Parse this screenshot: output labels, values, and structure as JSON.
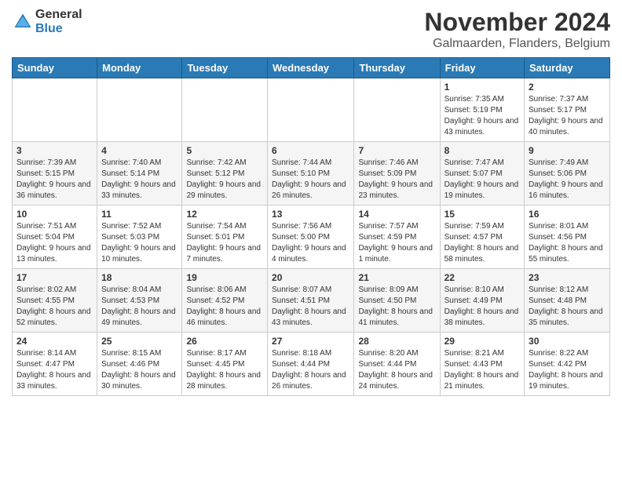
{
  "header": {
    "logo_general": "General",
    "logo_blue": "Blue",
    "month_title": "November 2024",
    "location": "Galmaarden, Flanders, Belgium"
  },
  "days_of_week": [
    "Sunday",
    "Monday",
    "Tuesday",
    "Wednesday",
    "Thursday",
    "Friday",
    "Saturday"
  ],
  "weeks": [
    [
      {
        "day": "",
        "info": ""
      },
      {
        "day": "",
        "info": ""
      },
      {
        "day": "",
        "info": ""
      },
      {
        "day": "",
        "info": ""
      },
      {
        "day": "",
        "info": ""
      },
      {
        "day": "1",
        "info": "Sunrise: 7:35 AM\nSunset: 5:19 PM\nDaylight: 9 hours and 43 minutes."
      },
      {
        "day": "2",
        "info": "Sunrise: 7:37 AM\nSunset: 5:17 PM\nDaylight: 9 hours and 40 minutes."
      }
    ],
    [
      {
        "day": "3",
        "info": "Sunrise: 7:39 AM\nSunset: 5:15 PM\nDaylight: 9 hours and 36 minutes."
      },
      {
        "day": "4",
        "info": "Sunrise: 7:40 AM\nSunset: 5:14 PM\nDaylight: 9 hours and 33 minutes."
      },
      {
        "day": "5",
        "info": "Sunrise: 7:42 AM\nSunset: 5:12 PM\nDaylight: 9 hours and 29 minutes."
      },
      {
        "day": "6",
        "info": "Sunrise: 7:44 AM\nSunset: 5:10 PM\nDaylight: 9 hours and 26 minutes."
      },
      {
        "day": "7",
        "info": "Sunrise: 7:46 AM\nSunset: 5:09 PM\nDaylight: 9 hours and 23 minutes."
      },
      {
        "day": "8",
        "info": "Sunrise: 7:47 AM\nSunset: 5:07 PM\nDaylight: 9 hours and 19 minutes."
      },
      {
        "day": "9",
        "info": "Sunrise: 7:49 AM\nSunset: 5:06 PM\nDaylight: 9 hours and 16 minutes."
      }
    ],
    [
      {
        "day": "10",
        "info": "Sunrise: 7:51 AM\nSunset: 5:04 PM\nDaylight: 9 hours and 13 minutes."
      },
      {
        "day": "11",
        "info": "Sunrise: 7:52 AM\nSunset: 5:03 PM\nDaylight: 9 hours and 10 minutes."
      },
      {
        "day": "12",
        "info": "Sunrise: 7:54 AM\nSunset: 5:01 PM\nDaylight: 9 hours and 7 minutes."
      },
      {
        "day": "13",
        "info": "Sunrise: 7:56 AM\nSunset: 5:00 PM\nDaylight: 9 hours and 4 minutes."
      },
      {
        "day": "14",
        "info": "Sunrise: 7:57 AM\nSunset: 4:59 PM\nDaylight: 9 hours and 1 minute."
      },
      {
        "day": "15",
        "info": "Sunrise: 7:59 AM\nSunset: 4:57 PM\nDaylight: 8 hours and 58 minutes."
      },
      {
        "day": "16",
        "info": "Sunrise: 8:01 AM\nSunset: 4:56 PM\nDaylight: 8 hours and 55 minutes."
      }
    ],
    [
      {
        "day": "17",
        "info": "Sunrise: 8:02 AM\nSunset: 4:55 PM\nDaylight: 8 hours and 52 minutes."
      },
      {
        "day": "18",
        "info": "Sunrise: 8:04 AM\nSunset: 4:53 PM\nDaylight: 8 hours and 49 minutes."
      },
      {
        "day": "19",
        "info": "Sunrise: 8:06 AM\nSunset: 4:52 PM\nDaylight: 8 hours and 46 minutes."
      },
      {
        "day": "20",
        "info": "Sunrise: 8:07 AM\nSunset: 4:51 PM\nDaylight: 8 hours and 43 minutes."
      },
      {
        "day": "21",
        "info": "Sunrise: 8:09 AM\nSunset: 4:50 PM\nDaylight: 8 hours and 41 minutes."
      },
      {
        "day": "22",
        "info": "Sunrise: 8:10 AM\nSunset: 4:49 PM\nDaylight: 8 hours and 38 minutes."
      },
      {
        "day": "23",
        "info": "Sunrise: 8:12 AM\nSunset: 4:48 PM\nDaylight: 8 hours and 35 minutes."
      }
    ],
    [
      {
        "day": "24",
        "info": "Sunrise: 8:14 AM\nSunset: 4:47 PM\nDaylight: 8 hours and 33 minutes."
      },
      {
        "day": "25",
        "info": "Sunrise: 8:15 AM\nSunset: 4:46 PM\nDaylight: 8 hours and 30 minutes."
      },
      {
        "day": "26",
        "info": "Sunrise: 8:17 AM\nSunset: 4:45 PM\nDaylight: 8 hours and 28 minutes."
      },
      {
        "day": "27",
        "info": "Sunrise: 8:18 AM\nSunset: 4:44 PM\nDaylight: 8 hours and 26 minutes."
      },
      {
        "day": "28",
        "info": "Sunrise: 8:20 AM\nSunset: 4:44 PM\nDaylight: 8 hours and 24 minutes."
      },
      {
        "day": "29",
        "info": "Sunrise: 8:21 AM\nSunset: 4:43 PM\nDaylight: 8 hours and 21 minutes."
      },
      {
        "day": "30",
        "info": "Sunrise: 8:22 AM\nSunset: 4:42 PM\nDaylight: 8 hours and 19 minutes."
      }
    ]
  ]
}
